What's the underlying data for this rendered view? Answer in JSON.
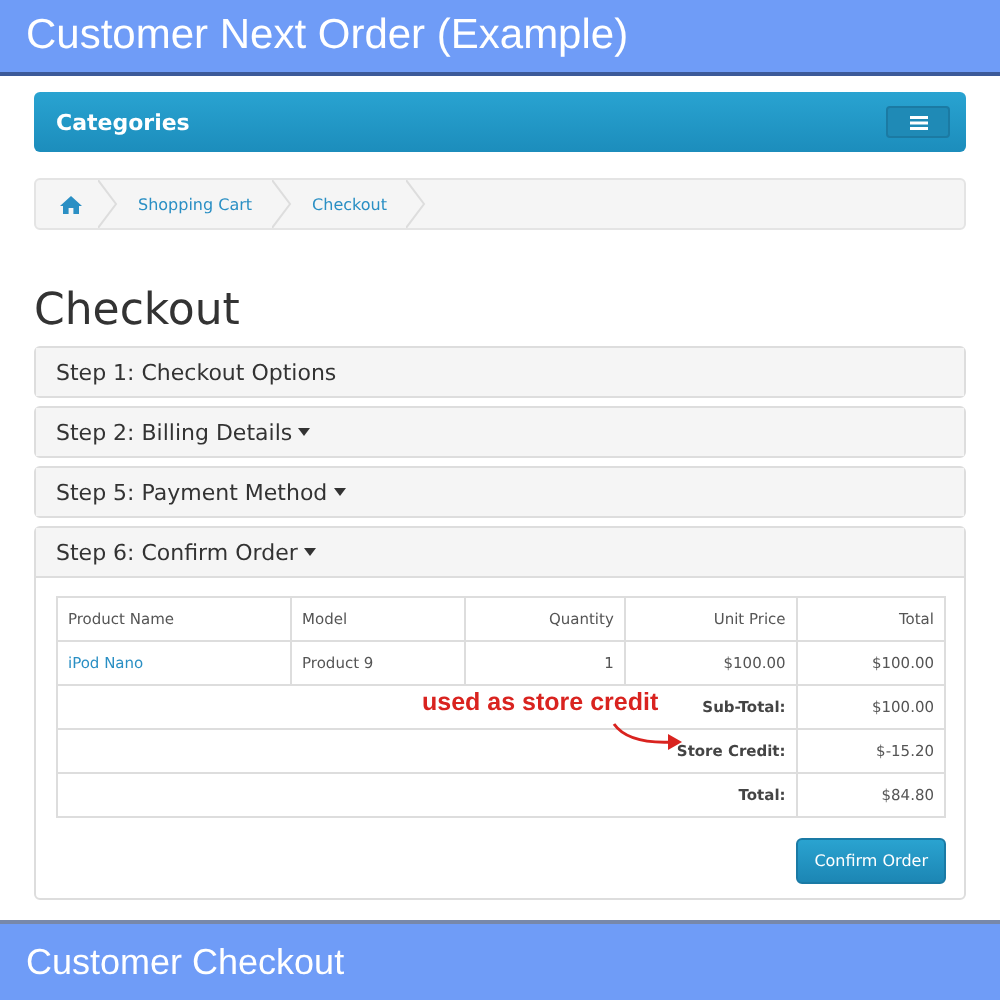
{
  "top_banner": {
    "title": "Customer Next Order (Example)"
  },
  "navbar": {
    "label": "Categories"
  },
  "breadcrumb": [
    "Shopping Cart",
    "Checkout"
  ],
  "heading": "Checkout",
  "steps": [
    {
      "label": "Step 1: Checkout Options",
      "caret": false,
      "expanded": false
    },
    {
      "label": "Step 2: Billing Details",
      "caret": true,
      "expanded": false
    },
    {
      "label": "Step 5: Payment Method",
      "caret": true,
      "expanded": false
    },
    {
      "label": "Step 6: Confirm Order",
      "caret": true,
      "expanded": true
    }
  ],
  "table": {
    "columns": [
      "Product Name",
      "Model",
      "Quantity",
      "Unit Price",
      "Total"
    ],
    "rows": [
      [
        "iPod Nano",
        "Product 9",
        "1",
        "$100.00",
        "$100.00"
      ]
    ],
    "totals": [
      {
        "label": "Sub-Total:",
        "value": "$100.00"
      },
      {
        "label": "Store Credit:",
        "value": "$-15.20"
      },
      {
        "label": "Total:",
        "value": "$84.80"
      }
    ]
  },
  "annotation": "used as store credit",
  "confirm_button": "Confirm Order",
  "bottom_banner": {
    "title": "Customer Checkout"
  }
}
